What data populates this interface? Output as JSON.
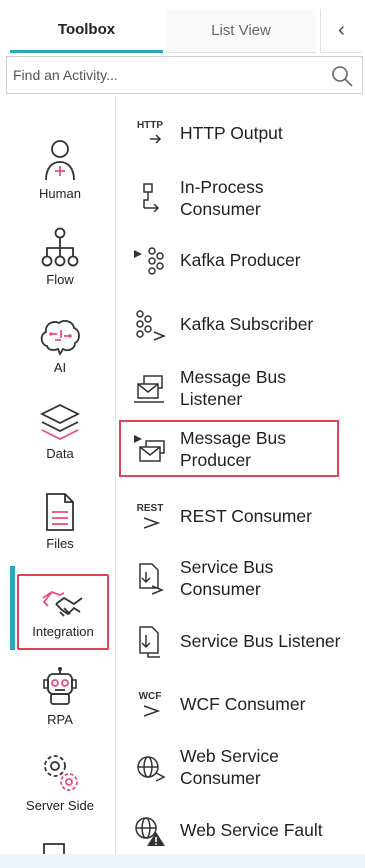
{
  "tabs": {
    "toolbox": "Toolbox",
    "list_view": "List View",
    "collapse_glyph": "‹"
  },
  "search": {
    "placeholder": "Find an Activity..."
  },
  "categories": [
    {
      "id": "human",
      "label": "Human",
      "icon": "human-icon"
    },
    {
      "id": "flow",
      "label": "Flow",
      "icon": "flow-icon"
    },
    {
      "id": "ai",
      "label": "AI",
      "icon": "ai-icon"
    },
    {
      "id": "data",
      "label": "Data",
      "icon": "data-icon"
    },
    {
      "id": "files",
      "label": "Files",
      "icon": "files-icon"
    },
    {
      "id": "integration",
      "label": "Integration",
      "icon": "integration-icon",
      "selected": true
    },
    {
      "id": "rpa",
      "label": "RPA",
      "icon": "rpa-icon"
    },
    {
      "id": "server_side",
      "label": "Server Side",
      "icon": "server-side-icon"
    }
  ],
  "activities": [
    {
      "label": "HTTP Output",
      "icon": "http-output-icon",
      "icon_text": "HTTP"
    },
    {
      "label": "In-Process Consumer",
      "icon": "in-process-consumer-icon"
    },
    {
      "label": "Kafka Producer",
      "icon": "kafka-producer-icon"
    },
    {
      "label": "Kafka Subscriber",
      "icon": "kafka-subscriber-icon"
    },
    {
      "label": "Message Bus Listener",
      "icon": "message-bus-listener-icon"
    },
    {
      "label": "Message Bus Producer",
      "icon": "message-bus-producer-icon",
      "highlighted": true
    },
    {
      "label": "REST Consumer",
      "icon": "rest-consumer-icon",
      "icon_text": "REST"
    },
    {
      "label": "Service Bus Consumer",
      "icon": "service-bus-consumer-icon"
    },
    {
      "label": "Service Bus Listener",
      "icon": "service-bus-listener-icon"
    },
    {
      "label": "WCF Consumer",
      "icon": "wcf-consumer-icon",
      "icon_text": "WCF"
    },
    {
      "label": "Web Service Consumer",
      "icon": "web-service-consumer-icon"
    },
    {
      "label": "Web Service Fault",
      "icon": "web-service-fault-icon"
    }
  ],
  "colors": {
    "accent": "#2aa7b8",
    "highlight": "#e04452",
    "icon_pink": "#e8507a",
    "icon_dark": "#333333"
  }
}
